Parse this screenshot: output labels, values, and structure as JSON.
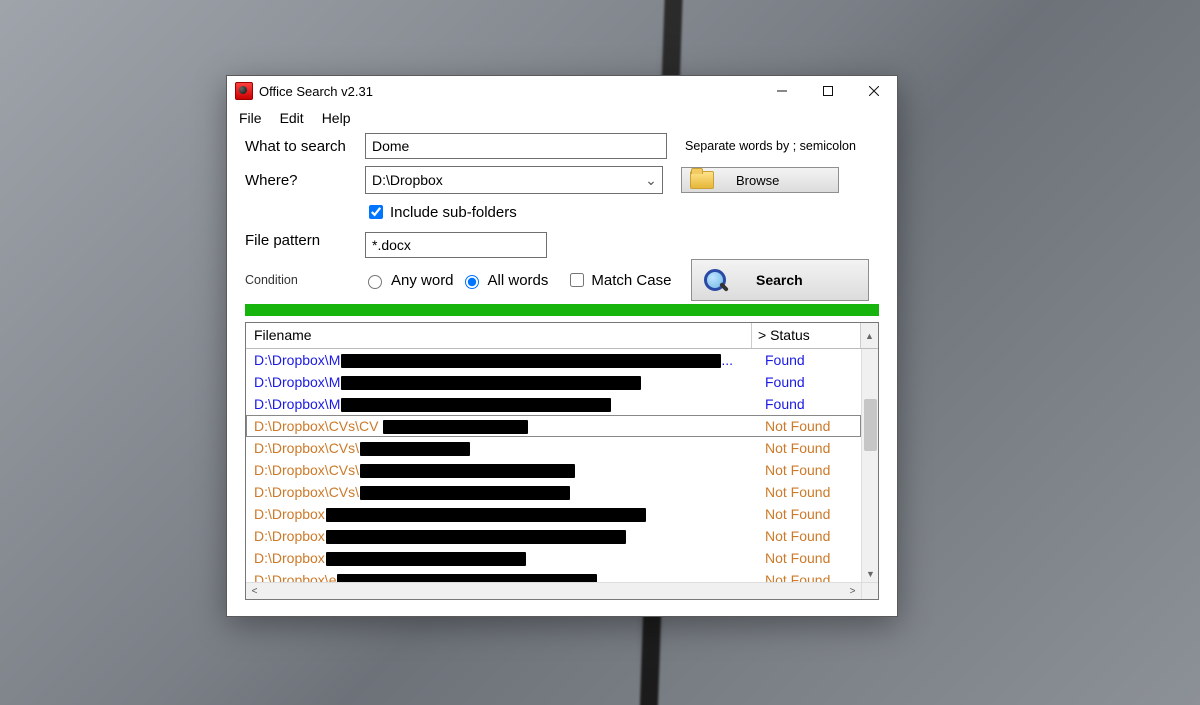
{
  "window": {
    "title": "Office Search v2.31"
  },
  "menu": {
    "file": "File",
    "edit": "Edit",
    "help": "Help"
  },
  "labels": {
    "what": "What to search",
    "where": "Where?",
    "include": "Include sub-folders",
    "pattern": "File pattern",
    "condition": "Condition",
    "any": "Any word",
    "all": "All words",
    "matchcase": "Match Case",
    "browse": "Browse",
    "search": "Search",
    "hint": "Separate words by ; semicolon",
    "col_file": "Filename",
    "col_status": "> Status"
  },
  "values": {
    "search_text": "Dome",
    "where_path": "D:\\Dropbox",
    "pattern": "*.docx",
    "include_sub": true,
    "radio_all": true,
    "matchcase": false
  },
  "status": {
    "found": "Found",
    "notfound": "Not Found"
  },
  "results": [
    {
      "prefix": "D:\\Dropbox\\M",
      "redact_w": 380,
      "ellipsis": true,
      "found": true
    },
    {
      "prefix": "D:\\Dropbox\\M",
      "redact_w": 300,
      "ellipsis": false,
      "found": true
    },
    {
      "prefix": "D:\\Dropbox\\M",
      "redact_w": 270,
      "ellipsis": false,
      "found": true
    },
    {
      "prefix": "D:\\Dropbox\\CVs\\CV ",
      "redact_w": 145,
      "ellipsis": false,
      "found": false,
      "selected": true
    },
    {
      "prefix": "D:\\Dropbox\\CVs\\",
      "redact_w": 110,
      "ellipsis": false,
      "found": false
    },
    {
      "prefix": "D:\\Dropbox\\CVs\\",
      "redact_w": 215,
      "ellipsis": false,
      "found": false
    },
    {
      "prefix": "D:\\Dropbox\\CVs\\",
      "redact_w": 210,
      "ellipsis": false,
      "found": false
    },
    {
      "prefix": "D:\\Dropbox",
      "redact_w": 320,
      "ellipsis": false,
      "found": false
    },
    {
      "prefix": "D:\\Dropbox",
      "redact_w": 300,
      "ellipsis": false,
      "found": false
    },
    {
      "prefix": "D:\\Dropbox",
      "redact_w": 200,
      "ellipsis": false,
      "found": false
    },
    {
      "prefix": "D:\\Dropbox\\e",
      "redact_w": 260,
      "ellipsis": false,
      "found": false
    }
  ]
}
